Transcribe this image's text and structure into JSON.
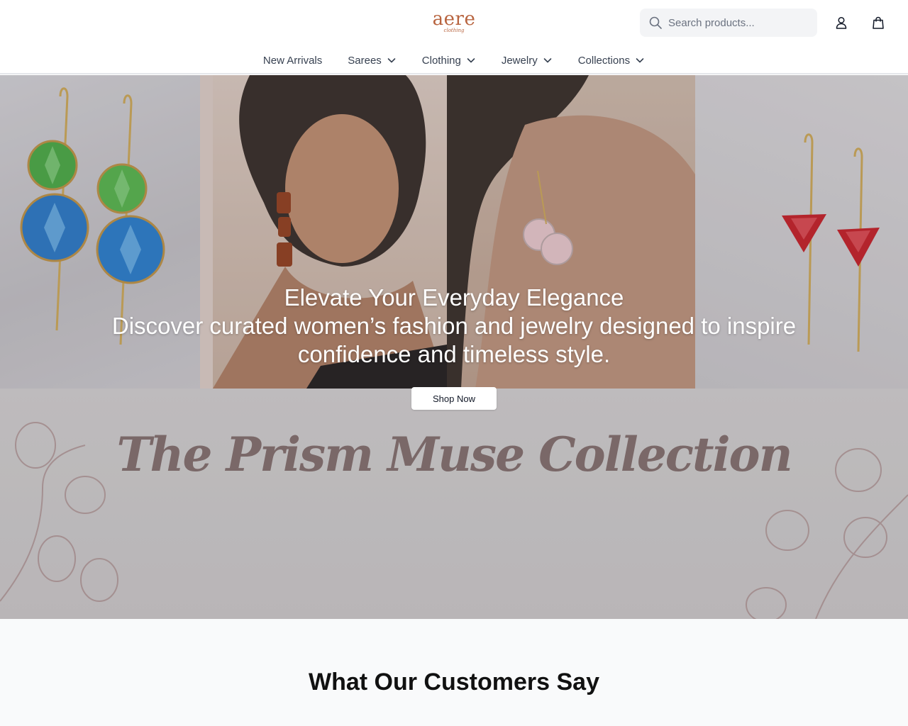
{
  "header": {
    "logo_text": "aere",
    "logo_subtext": "clothing",
    "search": {
      "placeholder": "Search products..."
    },
    "icons": {
      "search": "search-icon",
      "user": "user-icon",
      "cart": "shopping-bag-icon"
    }
  },
  "nav": {
    "items": [
      {
        "label": "New Arrivals",
        "has_dropdown": false
      },
      {
        "label": "Sarees",
        "has_dropdown": true
      },
      {
        "label": "Clothing",
        "has_dropdown": true
      },
      {
        "label": "Jewelry",
        "has_dropdown": true
      },
      {
        "label": "Collections",
        "has_dropdown": true
      }
    ]
  },
  "hero": {
    "title": "Elevate Your Everyday Elegance",
    "subtitle": "Discover curated women’s fashion and jewelry designed to inspire confidence and timeless style.",
    "cta_label": "Shop Now",
    "collection_title": "The Prism Muse Collection"
  },
  "testimonials": {
    "heading": "What Our Customers Say"
  },
  "colors": {
    "brand": "#b8643f",
    "collection_text": "#7a6868",
    "green_gem": "#3fa33a",
    "blue_gem": "#1e6fc2",
    "red_gem": "#c0121c",
    "amber_gem": "#8a3212",
    "pink_gem": "#e6c3c8",
    "gold_wire": "#c9a14d"
  }
}
